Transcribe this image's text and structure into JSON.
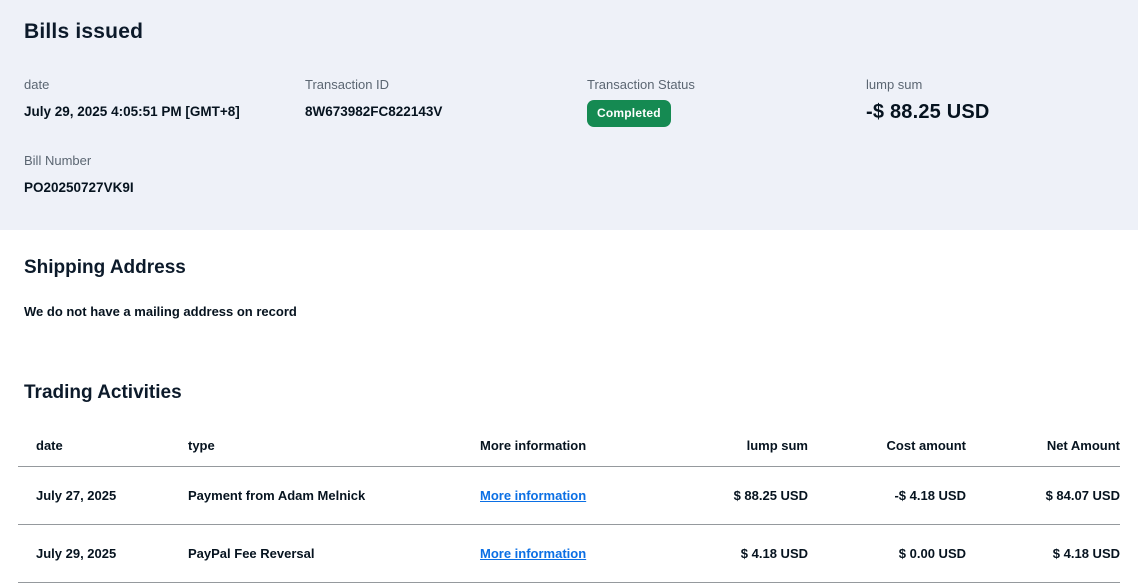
{
  "page": {
    "title": "Bills issued"
  },
  "summary": {
    "date": {
      "label": "date",
      "value": "July 29, 2025 4:05:51 PM [GMT+8]"
    },
    "transaction_id": {
      "label": "Transaction ID",
      "value": "8W673982FC822143V"
    },
    "status": {
      "label": "Transaction Status",
      "value": "Completed"
    },
    "lump_sum": {
      "label": "lump sum",
      "value": "-$ 88.25 USD"
    },
    "bill_number": {
      "label": "Bill Number",
      "value": "PO20250727VK9I"
    }
  },
  "shipping": {
    "title": "Shipping Address",
    "message": "We do not have a mailing address on record"
  },
  "trading": {
    "title": "Trading Activities",
    "columns": {
      "date": "date",
      "type": "type",
      "info": "More information",
      "lump_sum": "lump sum",
      "cost": "Cost amount",
      "net": "Net Amount"
    },
    "rows": [
      {
        "date": "July 27, 2025",
        "type": "Payment from Adam Melnick",
        "link": "More information",
        "lump_sum": "$ 88.25 USD",
        "cost": "-$ 4.18 USD",
        "net": "$ 84.07 USD"
      },
      {
        "date": "July 29, 2025",
        "type": "PayPal Fee Reversal",
        "link": "More information",
        "lump_sum": "$ 4.18 USD",
        "cost": "$ 0.00 USD",
        "net": "$ 4.18 USD"
      }
    ]
  },
  "colors": {
    "badge_green": "#158a52",
    "link_blue": "#0b6fe4",
    "band_background": "#eef1f8"
  }
}
